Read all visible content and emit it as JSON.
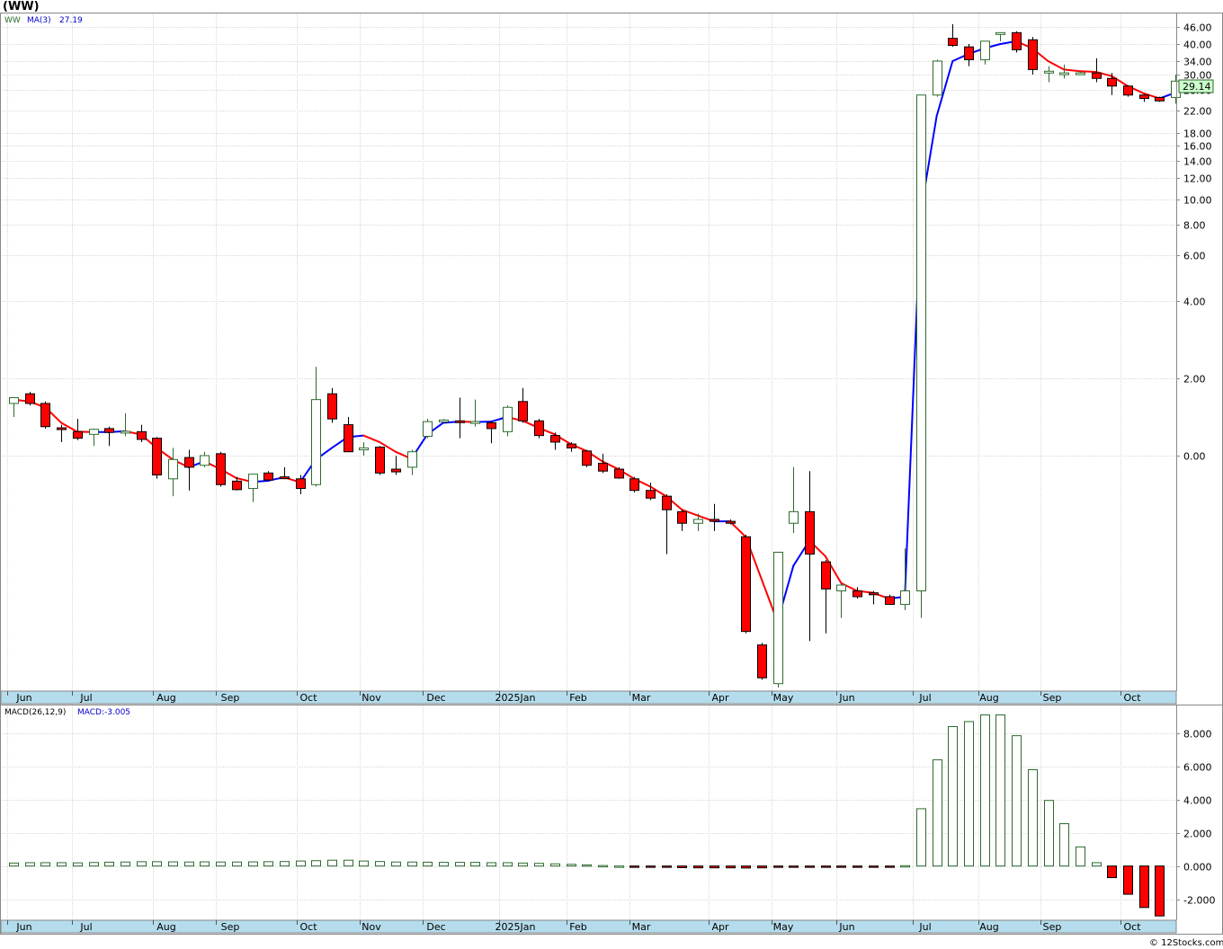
{
  "header": {
    "symbol_label": "(WW)"
  },
  "footer": {
    "credit": "© 12Stocks.com"
  },
  "colors": {
    "up_candle": "#ffffff",
    "up_outline": "#2d6b2d",
    "down_candle": "#ff0000",
    "ma_up": "#0000ff",
    "ma_down": "#ff0000",
    "axis_bar": "#b4dcec",
    "grid": "#d8d8d8"
  },
  "chart_data": [
    {
      "type": "candlestick",
      "title": "",
      "legend": {
        "ticker": "WW",
        "ma_label": "MA(3)",
        "ma_value": "27.19"
      },
      "last_price_label": "29.14",
      "y_scale": "symmetric-log",
      "y_ticks": [
        "46.00",
        "40.00",
        "34.00",
        "30.00",
        "28.00",
        "22.00",
        "18.00",
        "16.00",
        "14.00",
        "12.00",
        "10.00",
        "8.00",
        "6.00",
        "4.00",
        "2.00",
        "0.00"
      ],
      "x_month_labels": [
        "Jun",
        "Jul",
        "Aug",
        "Sep",
        "Oct",
        "Nov",
        "Dec",
        "2025Jan",
        "Feb",
        "Mar",
        "Apr",
        "May",
        "Jun",
        "Jul",
        "Aug",
        "Sep",
        "Oct"
      ],
      "candles": [
        {
          "o": 1.35,
          "h": 1.45,
          "l": 1.0,
          "c": 1.5
        },
        {
          "o": 1.6,
          "h": 1.65,
          "l": 1.3,
          "c": 1.35
        },
        {
          "o": 1.35,
          "h": 1.4,
          "l": 0.7,
          "c": 0.75
        },
        {
          "o": 0.72,
          "h": 0.8,
          "l": 0.35,
          "c": 0.7
        },
        {
          "o": 0.62,
          "h": 0.95,
          "l": 0.4,
          "c": 0.45
        },
        {
          "o": 0.55,
          "h": 0.7,
          "l": 0.25,
          "c": 0.68
        },
        {
          "o": 0.7,
          "h": 0.75,
          "l": 0.25,
          "c": 0.6
        },
        {
          "o": 0.6,
          "h": 1.1,
          "l": 0.5,
          "c": 0.63
        },
        {
          "o": 0.62,
          "h": 0.8,
          "l": 0.35,
          "c": 0.42
        },
        {
          "o": 0.45,
          "h": 0.48,
          "l": -0.6,
          "c": -0.5
        },
        {
          "o": -0.6,
          "h": 0.2,
          "l": -1.05,
          "c": -0.1
        },
        {
          "o": -0.05,
          "h": 0.15,
          "l": -0.9,
          "c": -0.3
        },
        {
          "o": -0.25,
          "h": 0.1,
          "l": -0.3,
          "c": 0.0
        },
        {
          "o": 0.05,
          "h": 0.1,
          "l": -0.8,
          "c": -0.75
        },
        {
          "o": -0.66,
          "h": -0.55,
          "l": -0.9,
          "c": -0.88
        },
        {
          "o": -0.85,
          "h": -0.5,
          "l": -1.2,
          "c": -0.48
        },
        {
          "o": -0.45,
          "h": -0.4,
          "l": -0.67,
          "c": -0.63
        },
        {
          "o": -0.55,
          "h": -0.3,
          "l": -0.6,
          "c": -0.58
        },
        {
          "o": -0.6,
          "h": -0.5,
          "l": -1.0,
          "c": -0.85
        },
        {
          "o": -0.75,
          "h": 2.3,
          "l": -0.8,
          "c": 1.45
        },
        {
          "o": 1.6,
          "h": 1.75,
          "l": 0.85,
          "c": 0.95
        },
        {
          "o": 0.8,
          "h": 1.0,
          "l": 0.15,
          "c": 0.1
        },
        {
          "o": 0.15,
          "h": 0.35,
          "l": 0.0,
          "c": 0.2
        },
        {
          "o": 0.22,
          "h": 0.25,
          "l": -0.5,
          "c": -0.45
        },
        {
          "o": -0.35,
          "h": 0.0,
          "l": -0.5,
          "c": -0.42
        },
        {
          "o": -0.3,
          "h": 0.15,
          "l": -0.5,
          "c": 0.1
        },
        {
          "o": 0.5,
          "h": 0.95,
          "l": 0.45,
          "c": 0.88
        },
        {
          "o": 0.88,
          "h": 0.95,
          "l": 0.85,
          "c": 0.92
        },
        {
          "o": 0.9,
          "h": 1.5,
          "l": 0.45,
          "c": 0.88
        },
        {
          "o": 0.87,
          "h": 1.45,
          "l": 0.75,
          "c": 0.88
        },
        {
          "o": 0.85,
          "h": 0.9,
          "l": 0.32,
          "c": 0.7
        },
        {
          "o": 0.62,
          "h": 1.3,
          "l": 0.5,
          "c": 1.25
        },
        {
          "o": 1.4,
          "h": 1.75,
          "l": 0.85,
          "c": 0.9
        },
        {
          "o": 0.9,
          "h": 0.95,
          "l": 0.45,
          "c": 0.52
        },
        {
          "o": 0.52,
          "h": 0.6,
          "l": 0.15,
          "c": 0.35
        },
        {
          "o": 0.3,
          "h": 0.35,
          "l": 0.1,
          "c": 0.2
        },
        {
          "o": 0.12,
          "h": 0.15,
          "l": -0.3,
          "c": -0.25
        },
        {
          "o": -0.2,
          "h": 0.05,
          "l": -0.45,
          "c": -0.4
        },
        {
          "o": -0.35,
          "h": -0.3,
          "l": -0.6,
          "c": -0.58
        },
        {
          "o": -0.6,
          "h": -0.55,
          "l": -0.95,
          "c": -0.9
        },
        {
          "o": -0.9,
          "h": -0.7,
          "l": -1.15,
          "c": -1.1
        },
        {
          "o": -1.05,
          "h": -1.0,
          "l": -2.55,
          "c": -1.4
        },
        {
          "o": -1.45,
          "h": -1.4,
          "l": -1.95,
          "c": -1.75
        },
        {
          "o": -1.75,
          "h": -1.5,
          "l": -1.95,
          "c": -1.65
        },
        {
          "o": -1.65,
          "h": -1.25,
          "l": -1.95,
          "c": -1.7
        },
        {
          "o": -1.7,
          "h": -1.65,
          "l": -1.78,
          "c": -1.75
        },
        {
          "o": -2.1,
          "h": -2.05,
          "l": -4.6,
          "c": -4.55
        },
        {
          "o": -4.9,
          "h": -4.85,
          "l": -5.8,
          "c": -5.75
        },
        {
          "o": -5.9,
          "h": -2.5,
          "l": -6.0,
          "c": -2.5
        },
        {
          "o": -1.75,
          "h": -0.3,
          "l": -2.0,
          "c": -1.45
        },
        {
          "o": -1.45,
          "h": -0.4,
          "l": -4.8,
          "c": -2.55
        },
        {
          "o": -2.75,
          "h": -2.7,
          "l": -4.6,
          "c": -3.45
        },
        {
          "o": -3.5,
          "h": -3.3,
          "l": -4.2,
          "c": -3.35
        },
        {
          "o": -3.5,
          "h": -3.4,
          "l": -3.7,
          "c": -3.65
        },
        {
          "o": -3.55,
          "h": -3.5,
          "l": -3.85,
          "c": -3.6
        },
        {
          "o": -3.65,
          "h": -3.6,
          "l": -3.85,
          "c": -3.85
        },
        {
          "o": -3.85,
          "h": -2.4,
          "l": -4.0,
          "c": -3.5
        },
        {
          "o": -3.5,
          "h": 3.4,
          "l": -4.2,
          "c": 26.5
        },
        {
          "o": 26.5,
          "h": 34.5,
          "l": 26.0,
          "c": 34.0
        },
        {
          "o": 42.0,
          "h": 47.0,
          "l": 39.0,
          "c": 39.5
        },
        {
          "o": 39.0,
          "h": 40.0,
          "l": 32.5,
          "c": 34.5
        },
        {
          "o": 34.5,
          "h": 41.0,
          "l": 33.0,
          "c": 41.0
        },
        {
          "o": 43.5,
          "h": 44.0,
          "l": 41.0,
          "c": 44.0
        },
        {
          "o": 44.0,
          "h": 44.5,
          "l": 37.0,
          "c": 38.0
        },
        {
          "o": 41.5,
          "h": 42.5,
          "l": 30.0,
          "c": 31.5
        },
        {
          "o": 31.0,
          "h": 32.5,
          "l": 29.0,
          "c": 31.0
        },
        {
          "o": 30.5,
          "h": 33.0,
          "l": 29.5,
          "c": 30.5
        },
        {
          "o": 30.5,
          "h": 31.0,
          "l": 30.0,
          "c": 30.5
        },
        {
          "o": 30.5,
          "h": 35.0,
          "l": 29.0,
          "c": 29.5
        },
        {
          "o": 29.5,
          "h": 30.5,
          "l": 26.5,
          "c": 28.5
        },
        {
          "o": 28.5,
          "h": 28.6,
          "l": 26.0,
          "c": 26.5
        },
        {
          "o": 26.5,
          "h": 26.8,
          "l": 24.5,
          "c": 25.5
        },
        {
          "o": 25.8,
          "h": 26.0,
          "l": 24.5,
          "c": 24.8
        },
        {
          "o": 25.8,
          "h": 30.0,
          "l": 24.0,
          "c": 29.14
        }
      ],
      "ma3": [
        1.45,
        1.4,
        1.25,
        0.85,
        0.62,
        0.61,
        0.61,
        0.63,
        0.55,
        0.2,
        -0.1,
        -0.3,
        -0.15,
        -0.35,
        -0.58,
        -0.68,
        -0.65,
        -0.56,
        -0.69,
        -0.1,
        0.2,
        0.48,
        0.52,
        0.35,
        0.1,
        -0.08,
        0.55,
        0.85,
        0.88,
        0.87,
        0.88,
        1.0,
        0.9,
        0.72,
        0.55,
        0.3,
        0.12,
        -0.15,
        -0.35,
        -0.6,
        -0.8,
        -1.05,
        -1.4,
        -1.55,
        -1.7,
        -1.7,
        -2.1,
        -3.2,
        -4.3,
        -2.85,
        -2.2,
        -2.6,
        -3.3,
        -3.5,
        -3.55,
        -3.7,
        -3.65,
        9.0,
        21.0,
        34.0,
        36.5,
        38.5,
        40.0,
        41.0,
        38.5,
        34.0,
        31.5,
        31.0,
        30.8,
        29.8,
        28.5,
        27.0,
        25.5,
        27.19
      ],
      "ma_up_color": "#0000ff",
      "ma_down_color": "#ff0000"
    },
    {
      "type": "bar",
      "title": "",
      "legend": {
        "name_label": "MACD(26,12,9)",
        "value_label": "MACD:-3.005"
      },
      "y_ticks": [
        "8.000",
        "6.000",
        "4.000",
        "2.000",
        "0.000",
        "-2.000"
      ],
      "ylim": [
        -3.05,
        9.4
      ],
      "x_month_labels": [
        "Jun",
        "Jul",
        "Aug",
        "Sep",
        "Oct",
        "Nov",
        "Dec",
        "2025Jan",
        "Feb",
        "Mar",
        "Apr",
        "May",
        "Jun",
        "Jul",
        "Aug",
        "Sep",
        "Oct"
      ],
      "values": [
        0.18,
        0.2,
        0.2,
        0.2,
        0.19,
        0.21,
        0.23,
        0.24,
        0.26,
        0.26,
        0.25,
        0.24,
        0.25,
        0.24,
        0.24,
        0.25,
        0.26,
        0.27,
        0.3,
        0.32,
        0.35,
        0.35,
        0.3,
        0.27,
        0.24,
        0.24,
        0.23,
        0.22,
        0.22,
        0.22,
        0.2,
        0.2,
        0.18,
        0.16,
        0.13,
        0.1,
        0.07,
        0.03,
        0.0,
        -0.03,
        -0.06,
        -0.08,
        -0.1,
        -0.11,
        -0.11,
        -0.11,
        -0.12,
        -0.11,
        -0.08,
        -0.06,
        -0.04,
        -0.03,
        -0.02,
        -0.02,
        -0.02,
        -0.01,
        0.02,
        3.45,
        6.4,
        8.4,
        8.7,
        9.1,
        9.1,
        7.85,
        5.8,
        3.95,
        2.55,
        1.15,
        0.2,
        -0.7,
        -1.7,
        -2.5,
        -3.005
      ]
    }
  ]
}
